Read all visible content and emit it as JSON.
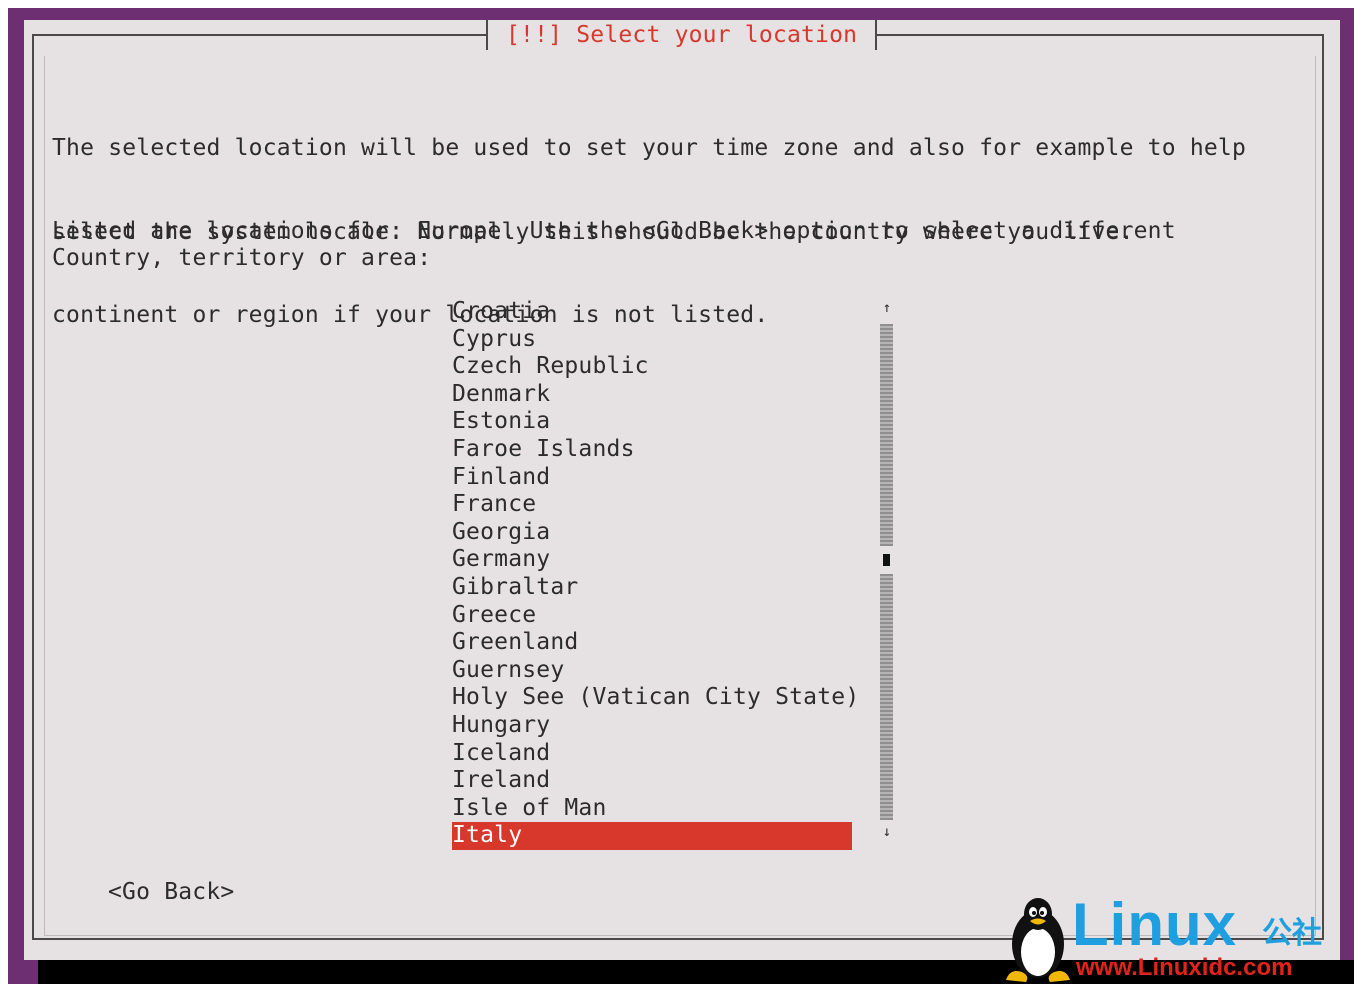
{
  "dialog": {
    "title": "[!!] Select your location",
    "paragraph1_line1": "The selected location will be used to set your time zone and also for example to help",
    "paragraph1_line2": "select the system locale. Normally this should be the country where you live.",
    "paragraph2_line1": "Listed are locations for: Europe. Use the <Go Back> option to select a different",
    "paragraph2_line2": "continent or region if your location is not listed.",
    "prompt": "Country, territory or area:"
  },
  "list": {
    "items": [
      "Croatia",
      "Cyprus",
      "Czech Republic",
      "Denmark",
      "Estonia",
      "Faroe Islands",
      "Finland",
      "France",
      "Georgia",
      "Germany",
      "Gibraltar",
      "Greece",
      "Greenland",
      "Guernsey",
      "Holy See (Vatican City State)",
      "Hungary",
      "Iceland",
      "Ireland",
      "Isle of Man",
      "Italy"
    ],
    "selected": "Italy",
    "scroll_up_icon": "arrow-up-icon",
    "scroll_down_icon": "arrow-down-icon",
    "scroll_up_glyph": "↑",
    "scroll_down_glyph": "↓"
  },
  "buttons": {
    "go_back": "<Go Back>"
  },
  "watermark": {
    "brand": "Linux",
    "suffix": "公社",
    "url": "www.Linuxidc.com"
  },
  "colors": {
    "accent": "#d7382b",
    "background": "#e6e2e4",
    "desktop": "#6e2e72",
    "watermark_blue": "#1ea0e0",
    "watermark_red": "#e0241c"
  }
}
